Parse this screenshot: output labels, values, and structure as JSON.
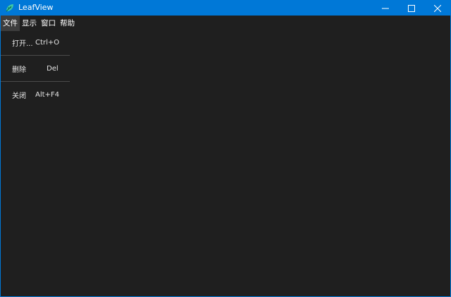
{
  "window": {
    "title": "LeafView",
    "accent_color": "#0078d7",
    "icon": "leaf-icon"
  },
  "title_controls": {
    "minimize_icon": "minimize-icon",
    "maximize_icon": "maximize-icon",
    "close_icon": "close-icon"
  },
  "menubar": {
    "items": [
      {
        "label": "文件"
      },
      {
        "label": "显示"
      },
      {
        "label": "窗口"
      },
      {
        "label": "帮助"
      }
    ]
  },
  "file_menu": {
    "items": [
      {
        "label": "打开...",
        "shortcut": "Ctrl+O"
      },
      {
        "label": "删除",
        "shortcut": "Del"
      },
      {
        "label": "关闭",
        "shortcut": "Alt+F4"
      }
    ]
  }
}
